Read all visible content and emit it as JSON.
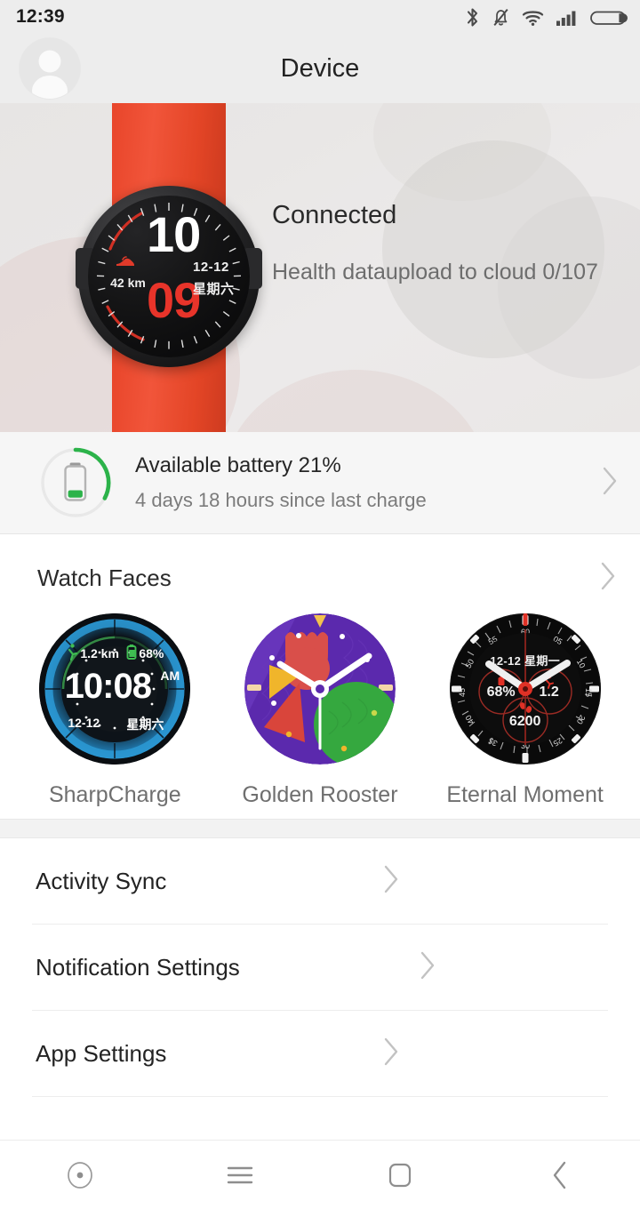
{
  "statusbar": {
    "time": "12:39",
    "icons": [
      "bluetooth-icon",
      "bell-muted-icon",
      "wifi-icon",
      "signal-icon",
      "battery-icon"
    ]
  },
  "header": {
    "title": "Device",
    "avatar": "user-avatar-icon"
  },
  "hero": {
    "status": "Connected",
    "sub": "Health dataupload to cloud 0/107",
    "watch": {
      "hour": "10",
      "minute": "09",
      "distance": "42 km",
      "date": "12-12",
      "weekday": "星期六",
      "strap_color": "#e8452a",
      "accent_color": "#e8342a"
    }
  },
  "battery": {
    "title": "Available battery 21%",
    "sub": "4 days 18 hours since last charge",
    "percent": 21,
    "ring_color": "#2cb34a",
    "chevron": "chevron-right-icon"
  },
  "watch_faces": {
    "title": "Watch Faces",
    "chevron": "chevron-right-icon",
    "items": [
      {
        "label": "SharpCharge",
        "time": "10:08",
        "meridiem": "AM",
        "distance": "1.2 km",
        "battery": "68%",
        "date": "12-12",
        "weekday": "星期六",
        "color": "#1f7fb5"
      },
      {
        "label": "Golden Rooster",
        "color": "#5b2bb0"
      },
      {
        "label": "Eternal Moment",
        "date_line": "12-12 星期一",
        "battery": "68%",
        "distance": "1.2",
        "steps": "6200",
        "color": "#0c0c0c"
      }
    ]
  },
  "settings": {
    "rows": [
      {
        "label": "Activity Sync",
        "chevron": "chevron-right-icon"
      },
      {
        "label": "Notification Settings",
        "chevron": "chevron-right-icon"
      },
      {
        "label": "App Settings",
        "chevron": "chevron-right-icon"
      }
    ]
  },
  "navbar": {
    "buttons": [
      "record-dot-icon",
      "menu-icon",
      "home-icon",
      "back-icon"
    ]
  }
}
